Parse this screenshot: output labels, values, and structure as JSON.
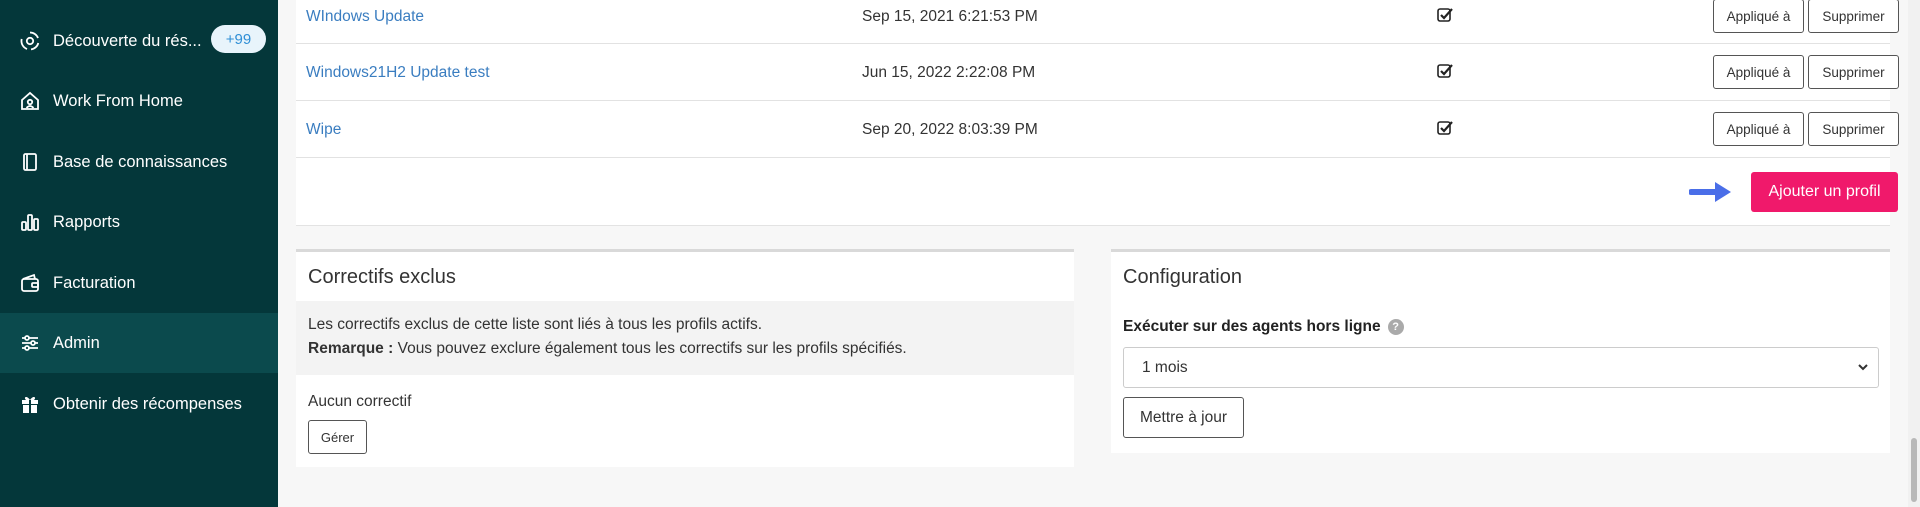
{
  "sidebar": {
    "items": [
      {
        "label": "Découverte du rés...",
        "icon": "network-discovery-icon",
        "badge": "+99",
        "active": false
      },
      {
        "label": "Work From Home",
        "icon": "home-icon",
        "active": false
      },
      {
        "label": "Base de connaissances",
        "icon": "book-icon",
        "active": false
      },
      {
        "label": "Rapports",
        "icon": "bar-chart-icon",
        "active": false
      },
      {
        "label": "Facturation",
        "icon": "wallet-icon",
        "active": false
      },
      {
        "label": "Admin",
        "icon": "sliders-icon",
        "active": true
      },
      {
        "label": "Obtenir des récompenses",
        "icon": "gift-icon",
        "active": false
      }
    ]
  },
  "profiles": {
    "rows": [
      {
        "name": "WIndows Update",
        "date": "Sep 15, 2021 6:21:53 PM",
        "checked": true,
        "applied_label": "Appliqué à",
        "delete_label": "Supprimer"
      },
      {
        "name": "Windows21H2 Update test",
        "date": "Jun 15, 2022 2:22:08 PM",
        "checked": true,
        "applied_label": "Appliqué à",
        "delete_label": "Supprimer"
      },
      {
        "name": "Wipe",
        "date": "Sep 20, 2022 8:03:39 PM",
        "checked": true,
        "applied_label": "Appliqué à",
        "delete_label": "Supprimer"
      }
    ],
    "add_label": "Ajouter un profil"
  },
  "excluded": {
    "title": "Correctifs exclus",
    "note_line1": "Les correctifs exclus de cette liste sont liés à tous les profils actifs.",
    "note_bold": "Remarque :",
    "note_line2": " Vous pouvez exclure également tous les correctifs sur les profils spécifiés.",
    "empty_text": "Aucun correctif",
    "manage_label": "Gérer"
  },
  "configuration": {
    "title": "Configuration",
    "field_label": "Exécuter sur des agents hors ligne",
    "selected_option": "1 mois",
    "update_label": "Mettre à jour"
  },
  "colors": {
    "sidebar_bg": "#04373a",
    "accent_pink": "#f0196b",
    "link_blue": "#3a7dc0",
    "arrow_blue": "#4a6ee8"
  }
}
